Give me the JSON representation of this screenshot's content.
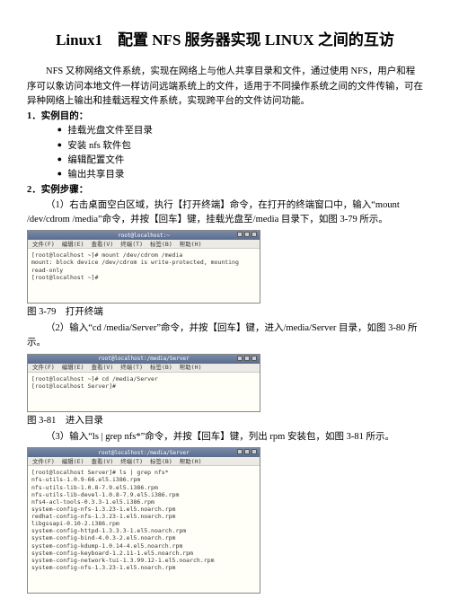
{
  "title": "Linux1　配置 NFS 服务器实现 LINUX 之间的互访",
  "intro": "NFS 又称网络文件系统，实现在网络上与他人共享目录和文件，通过使用 NFS，用户和程序可以象访问本地文件一样访问远端系统上的文件，适用于不同操作系统之间的文件传输，可在异种网络上输出和挂载远程文件系统，实现跨平台的文件访问功能。",
  "sect1": "1．实例目的：",
  "goals": [
    "挂载光盘文件至目录",
    "安装 nfs 软件包",
    "编辑配置文件",
    "输出共享目录"
  ],
  "sect2": "2．实例步骤：",
  "step1": "（1）右击桌面空白区域，执行【打开终端】命令，在打开的终端窗口中，输入“mount /dev/cdrom /media”命令，并按【回车】键，挂载光盘至/media 目录下，如图 3-79 所示。",
  "cap1": "图 3-79　打开终端",
  "step2": "（2）输入“cd /media/Server”命令，并按【回车】键，进入/media/Server 目录，如图 3-80 所示。",
  "cap2": "图 3-81　进入目录",
  "step3": "（3）输入“ls | grep nfs*”命令，并按【回车】键，列出 rpm 安装包，如图 3-81 所示。",
  "win": {
    "title1": "root@localhost:~",
    "title2": "root@localhost:/media/Server",
    "title3": "root@localhost:/media/Server",
    "menu": {
      "file": "文件(F)",
      "edit": "编辑(E)",
      "view": "查看(V)",
      "term": "终端(T)",
      "tabs": "标签(B)",
      "help": "帮助(H)"
    }
  },
  "term1": "[root@localhost ~]# mount /dev/cdrom /media\nmount: block device /dev/cdrom is write-protected, mounting read-only\n[root@localhost ~]#",
  "term2": "[root@localhost ~]# cd /media/Server\n[root@localhost Server]#",
  "term3": "[root@localhost Server]# ls | grep nfs*\nnfs-utils-1.0.9-66.el5.i386.rpm\nnfs-utils-lib-1.0.8-7.9.el5.i386.rpm\nnfs-utils-lib-devel-1.0.8-7.9.el5.i386.rpm\nnfs4-acl-tools-0.3.3-1.el5.i386.rpm\nsystem-config-nfs-1.3.23-1.el5.noarch.rpm\nredhat-config-nfs-1.3.23-1.el5.noarch.rpm\nlibgssapi-0.10-2.i386.rpm\nsystem-config-httpd-1.3.3.3-1.el5.noarch.rpm\nsystem-config-bind-4.0.3-2.el5.noarch.rpm\nsystem-config-kdump-1.0.14-4.el5.noarch.rpm\nsystem-config-keyboard-1.2.11-1.el5.noarch.rpm\nsystem-config-network-tui-1.3.99.12-1.el5.noarch.rpm\nsystem-config-nfs-1.3.23-1.el5.noarch.rpm"
}
